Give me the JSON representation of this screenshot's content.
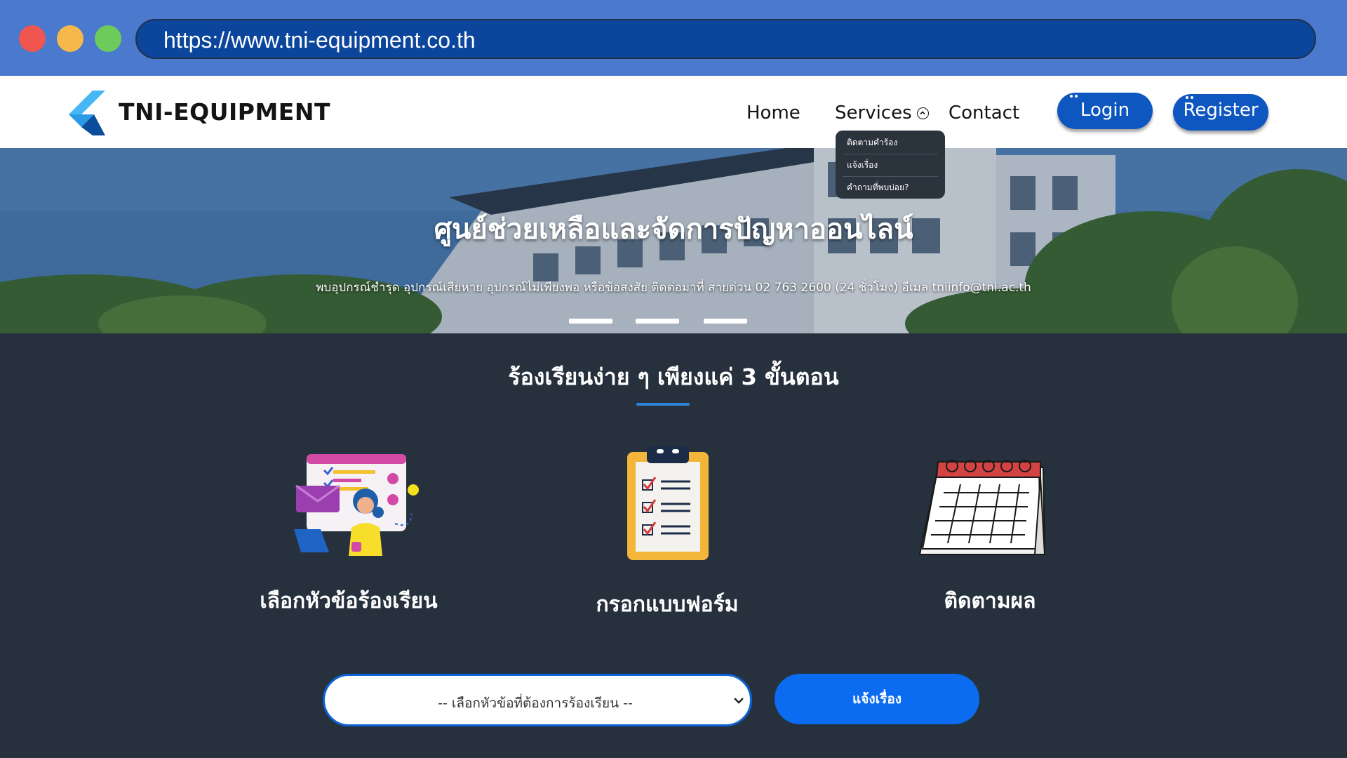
{
  "browser": {
    "url": "https://www.tni-equipment.co.th"
  },
  "navbar": {
    "brand": "TNI-EQUIPMENT",
    "links": {
      "home": "Home",
      "services": "Services",
      "contact": "Contact"
    },
    "login_label": "Login",
    "register_label": "Register"
  },
  "services_menu": {
    "items": [
      "ติดตามคำร้อง",
      "แจ้งเรื่อง",
      "คำถามที่พบบ่อย?"
    ]
  },
  "hero": {
    "title": "ศูนย์ช่วยเหลือและจัดการปัญหาออนไลน์",
    "subtitle": "พบอุปกรณ์ชำรุด อุปกรณ์เสียหาย อุปกรณ์ไม่เพียงพอ หรือข้อสงสัย ติดต่อมาที่ สายด่วน 02 763 2600 (24 ชั่วโมง) อีเมล tniinfo@tni.ac.th",
    "slide_count": 3
  },
  "steps": {
    "title": "ร้องเรียนง่าย ๆ เพียงแค่ 3 ขั้นตอน",
    "items": [
      {
        "label": "เลือกหัวข้อร้องเรียน",
        "icon": "person-choosing-topic-icon"
      },
      {
        "label": "กรอกแบบฟอร์ม",
        "icon": "clipboard-checklist-icon"
      },
      {
        "label": "ติดตามผล",
        "icon": "calendar-icon"
      }
    ]
  },
  "form": {
    "select_value": "-- เลือกหัวข้อที่ต้องการร้องเรียน --",
    "submit_label": "แจ้งเรื่อง"
  },
  "colors": {
    "chrome_bg": "#4a79cd",
    "url_bar": "#0b469c",
    "nav_button": "#0e56c0",
    "page_bg": "#26313d",
    "accent": "#2d86dc",
    "submit": "#0b6cf2"
  }
}
